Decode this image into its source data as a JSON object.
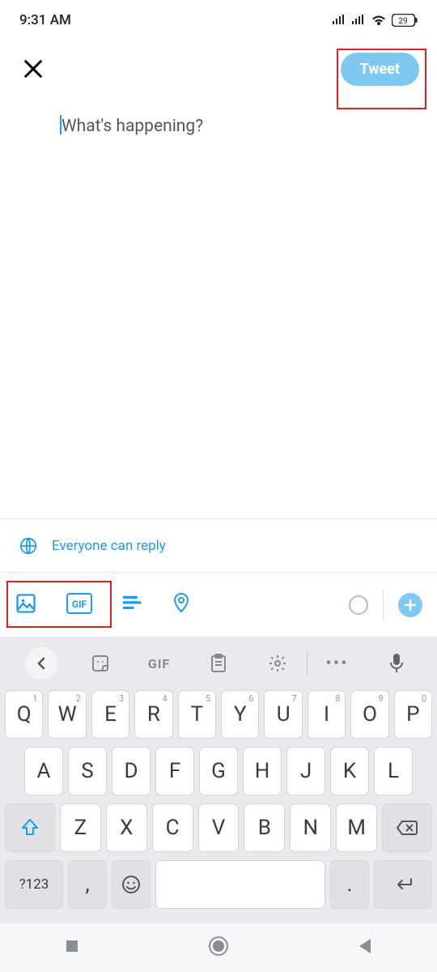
{
  "status": {
    "time": "9:31 AM",
    "battery": "29"
  },
  "header": {
    "tweet_label": "Tweet"
  },
  "compose": {
    "placeholder": "What's happening?"
  },
  "reply": {
    "text": "Everyone can reply"
  },
  "attach": {
    "gif_badge": "GIF"
  },
  "keyboard": {
    "toolbar_gif": "GIF",
    "row1": [
      {
        "ch": "Q",
        "hint": "1"
      },
      {
        "ch": "W",
        "hint": "2"
      },
      {
        "ch": "E",
        "hint": "3"
      },
      {
        "ch": "R",
        "hint": "4"
      },
      {
        "ch": "T",
        "hint": "5"
      },
      {
        "ch": "Y",
        "hint": "6"
      },
      {
        "ch": "U",
        "hint": "7"
      },
      {
        "ch": "I",
        "hint": "8"
      },
      {
        "ch": "O",
        "hint": "9"
      },
      {
        "ch": "P",
        "hint": "0"
      }
    ],
    "row2": [
      "A",
      "S",
      "D",
      "F",
      "G",
      "H",
      "J",
      "K",
      "L"
    ],
    "row3": [
      "Z",
      "X",
      "C",
      "V",
      "B",
      "N",
      "M"
    ],
    "sym": "?123",
    "comma": ",",
    "period": "."
  }
}
